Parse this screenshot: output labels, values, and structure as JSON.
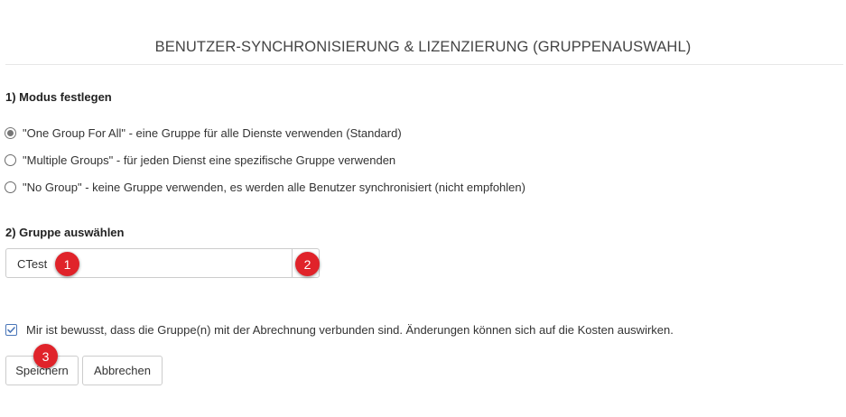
{
  "header": {
    "title": "BENUTZER-SYNCHRONISIERUNG & LIZENZIERUNG (GRUPPENAUSWAHL)"
  },
  "mode_section": {
    "heading": "1) Modus festlegen",
    "options": [
      {
        "label": "\"One Group For All\" - eine Gruppe für alle Dienste verwenden (Standard)",
        "selected": true
      },
      {
        "label": "\"Multiple Groups\" - für jeden Dienst eine spezifische Gruppe verwenden",
        "selected": false
      },
      {
        "label": "\"No Group\" - keine Gruppe verwenden, es werden alle Benutzer synchronisiert (nicht empfohlen)",
        "selected": false
      }
    ]
  },
  "group_section": {
    "heading": "2) Gruppe auswählen",
    "selected_group": "CTest"
  },
  "confirmation": {
    "checked": true,
    "label": "Mir ist bewusst, dass die Gruppe(n) mit der Abrechnung verbunden sind. Änderungen können sich auf die Kosten auswirken."
  },
  "actions": {
    "save_label": "Speichern",
    "cancel_label": "Abbrechen"
  },
  "callouts": {
    "one": "1",
    "two": "2",
    "three": "3"
  },
  "colors": {
    "callout": "#e0232a",
    "checkbox_accent": "#4a76b8"
  }
}
